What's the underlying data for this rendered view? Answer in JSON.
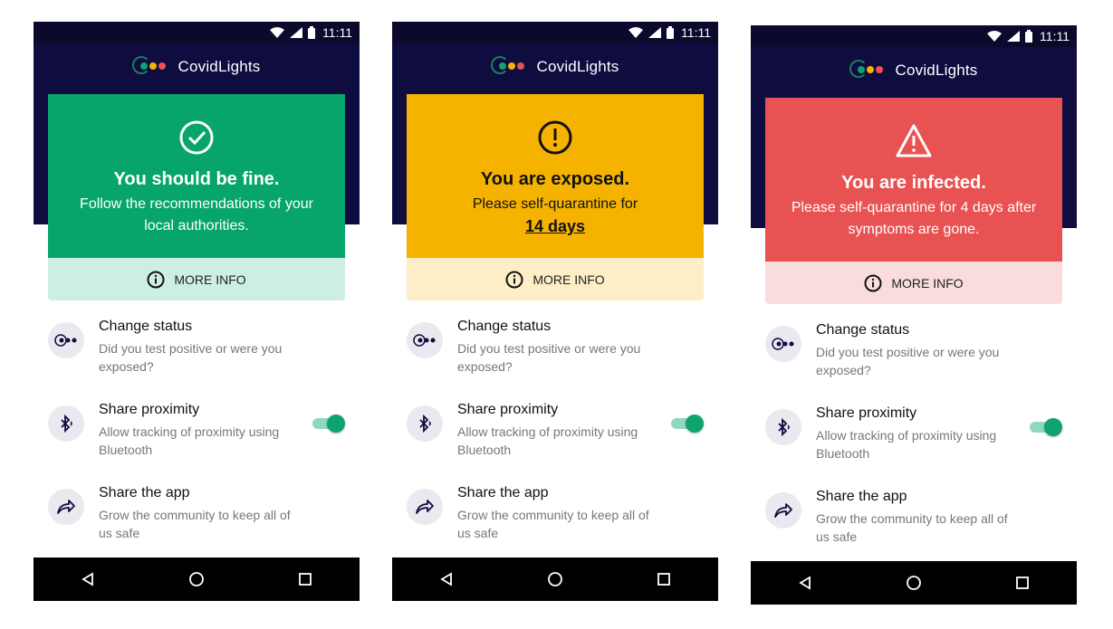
{
  "app": {
    "name": "CovidLights"
  },
  "status_bar": {
    "time": "11:11"
  },
  "phones": [
    {
      "card_color": "#07a56c",
      "info_color": "#cdeee4",
      "card_text_color": "#ffffff",
      "icon": "check-circle-icon",
      "title": "You should be fine.",
      "message": "Follow the recommendations of your local authorities.",
      "days": ""
    },
    {
      "card_color": "#f5b300",
      "info_color": "#fdeec7",
      "card_text_color": "#111111",
      "icon": "exclamation-circle-icon",
      "title": "You are exposed.",
      "message": "Please self-quarantine for",
      "days": "14 days"
    },
    {
      "card_color": "#e85252",
      "info_color": "#f9dcdc",
      "card_text_color": "#ffffff",
      "icon": "warning-triangle-icon",
      "title": "You are infected.",
      "message": "Please self-quarantine for 4 days after symptoms are gone.",
      "days": ""
    }
  ],
  "more_info": {
    "label": "MORE INFO"
  },
  "items": {
    "change_status": {
      "title": "Change status",
      "desc": "Did you test positive or were you exposed?",
      "icon": "traffic-lights-icon"
    },
    "share_proximity": {
      "title": "Share proximity",
      "desc": "Allow tracking of proximity using Bluetooth",
      "icon": "bluetooth-icon",
      "toggle_on": true
    },
    "share_app": {
      "title": "Share the app",
      "desc": "Grow the community to keep all of us safe",
      "icon": "share-arrow-icon"
    }
  },
  "colors": {
    "header": "#0f0c40",
    "accent_green": "#07a56c",
    "accent_yellow": "#f5b300",
    "accent_red": "#e85252"
  }
}
